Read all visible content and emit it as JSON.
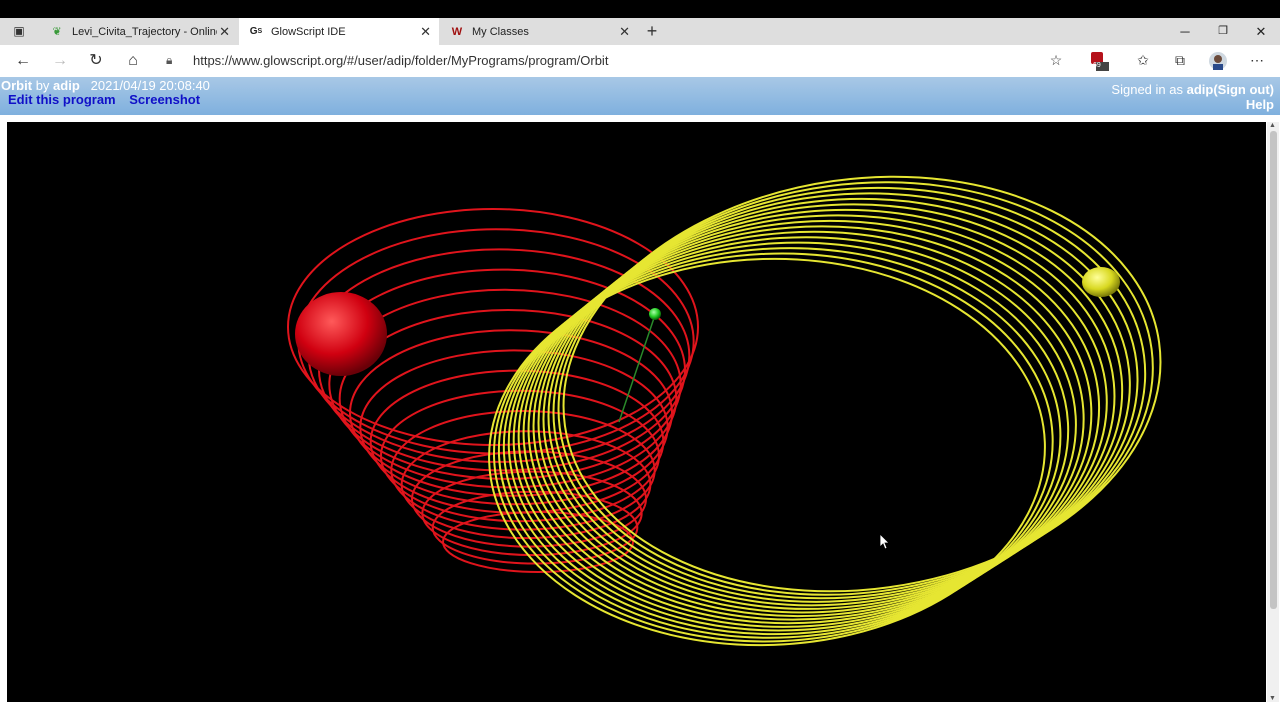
{
  "browser": {
    "tabs": [
      {
        "title": "Levi_Civita_Trajectory - Online La",
        "icon": "overleaf-icon"
      },
      {
        "title": "GlowScript IDE",
        "icon": "glowscript-icon"
      },
      {
        "title": "My Classes",
        "icon": "classes-icon"
      }
    ],
    "url": "https://www.glowscript.org/#/user/adip/folder/MyPrograms/program/Orbit",
    "extension_badge": "69"
  },
  "glowscript": {
    "program": "Orbit",
    "by": "by",
    "author": "adip",
    "timestamp": "2021/04/19 20:08:40",
    "edit_link": "Edit this program",
    "screenshot_link": "Screenshot",
    "signed_in_prefix": "Signed in as",
    "user": "adip",
    "sign_out": "(Sign out)",
    "help": "Help"
  },
  "scene": {
    "background": "#000000",
    "red_color": "#e0141c",
    "yellow_color": "#e6e632",
    "green_color": "#22cc22"
  }
}
